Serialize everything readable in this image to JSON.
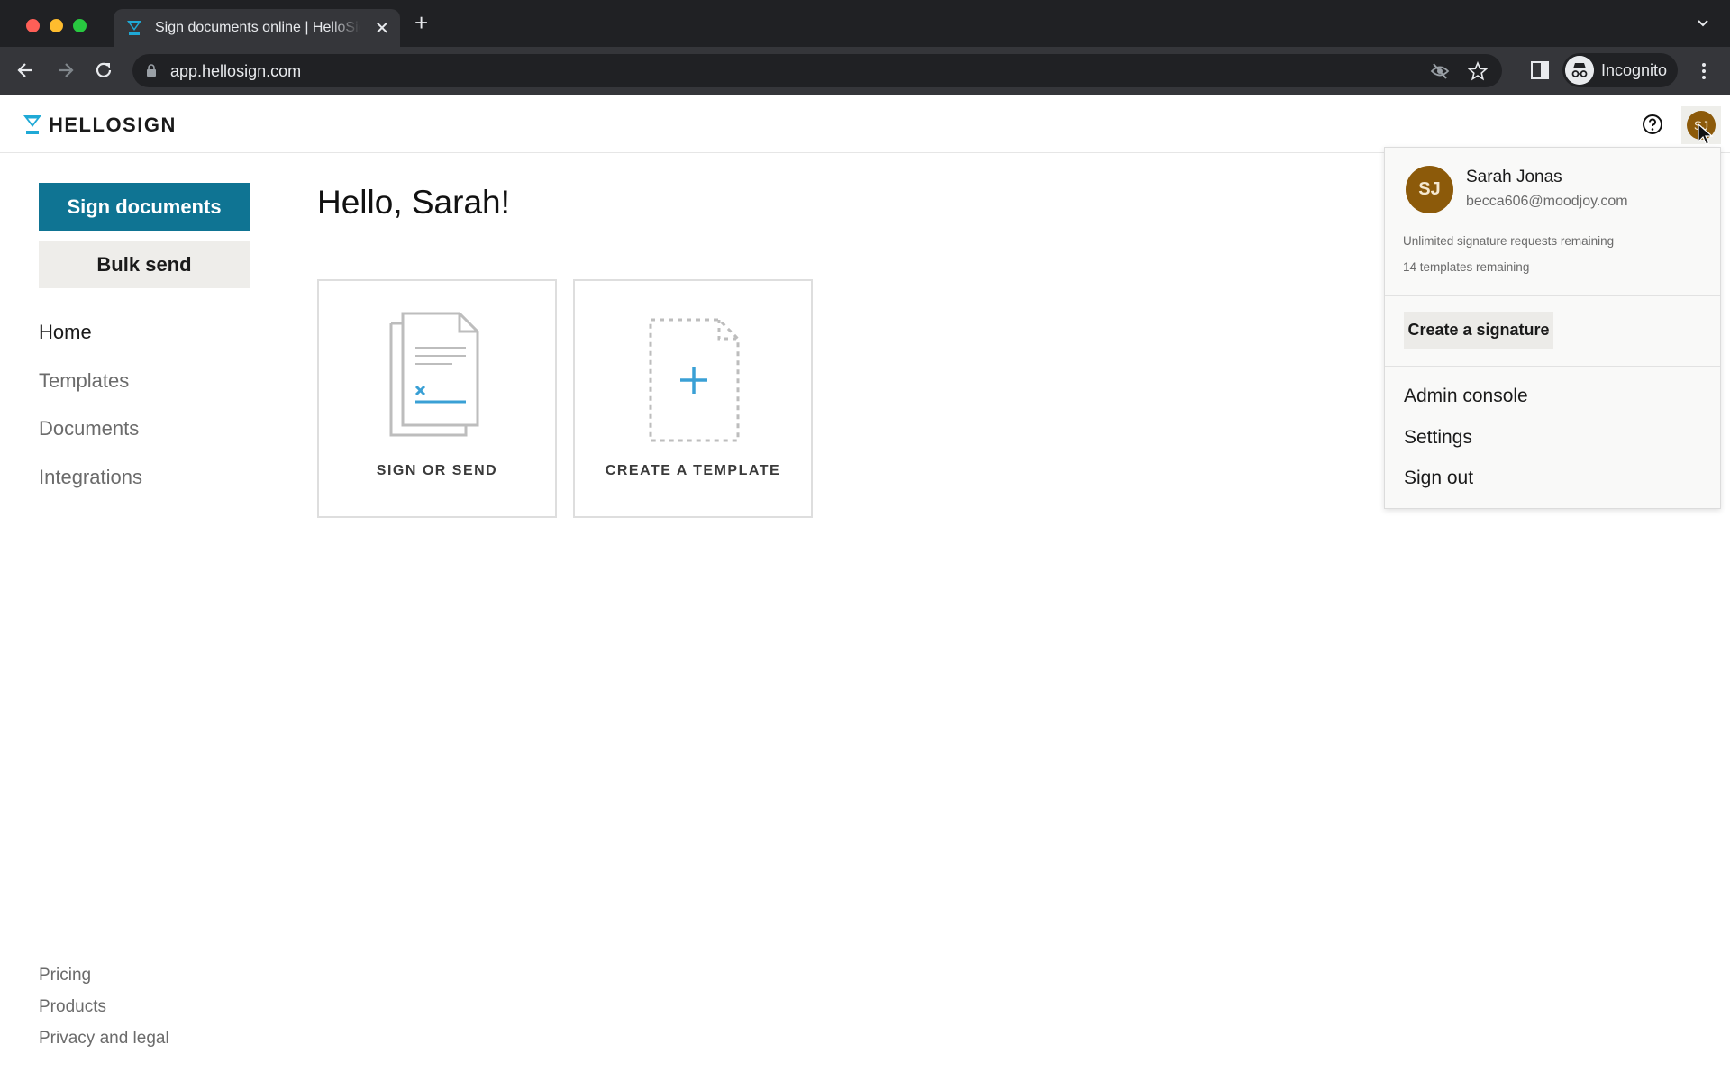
{
  "browser": {
    "tab_title": "Sign documents online | HelloSign",
    "url": "app.hellosign.com",
    "profile_label": "Incognito",
    "icons": {
      "back": "arrow-left-icon",
      "forward": "arrow-right-icon",
      "reload": "reload-icon",
      "lock": "lock-icon",
      "tracking": "eye-off-icon",
      "bookmark": "star-icon",
      "side_panel": "side-panel-icon",
      "menu": "kebab-menu-icon",
      "new_tab": "plus-icon",
      "tab_close": "close-icon",
      "tab_search": "chevron-down-icon"
    },
    "new_tab_glyph": "+",
    "close_glyph": "✕"
  },
  "app_header": {
    "brand": "HELLOSIGN",
    "avatar_initials": "SJ",
    "colors": {
      "brand_accent": "#1fa9d6",
      "avatar_bg": "#8c5a0a"
    }
  },
  "sidebar": {
    "primary_button": "Sign documents",
    "secondary_button": "Bulk send",
    "nav_items": [
      {
        "label": "Home",
        "active": true
      },
      {
        "label": "Templates",
        "active": false
      },
      {
        "label": "Documents",
        "active": false
      },
      {
        "label": "Integrations",
        "active": false
      }
    ],
    "footer_links": [
      "Pricing",
      "Products",
      "Privacy and legal"
    ],
    "colors": {
      "primary": "#0f7493"
    }
  },
  "main": {
    "greeting": "Hello, Sarah!",
    "cards": [
      {
        "label": "SIGN OR SEND",
        "icon": "document-sign-icon"
      },
      {
        "label": "CREATE A TEMPLATE",
        "icon": "add-template-icon"
      }
    ]
  },
  "account_menu": {
    "initials": "SJ",
    "name": "Sarah Jonas",
    "email": "becca606@moodjoy.com",
    "quota_signatures": "Unlimited signature requests remaining",
    "quota_templates": "14 templates remaining",
    "create_signature": "Create a signature",
    "items": [
      "Admin console",
      "Settings",
      "Sign out"
    ]
  }
}
